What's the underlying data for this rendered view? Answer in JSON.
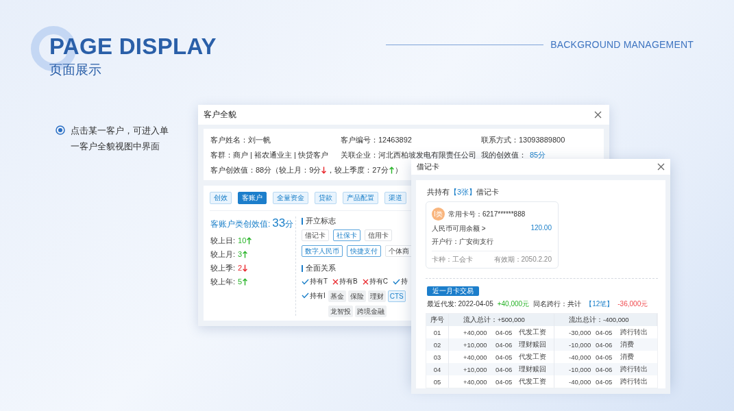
{
  "header": {
    "title": "PAGE DISPLAY",
    "subtitle": "页面展示",
    "section": "BACKGROUND MANAGEMENT"
  },
  "bullets": [
    {
      "text": "点击某一客户，可进入单一客户全貌视图中界面",
      "selected": true
    }
  ],
  "customer_window": {
    "title": "客户全貌",
    "fields": [
      {
        "label": "客户姓名：",
        "value": "刘一帆",
        "accent": false
      },
      {
        "label": "客户编号：",
        "value": "12463892",
        "accent": false
      },
      {
        "label": "联系方式：",
        "value": "13093889800",
        "accent": false
      },
      {
        "label": "客群：",
        "value": "商户 | 裕农通业主 | 快贷客户",
        "accent": false
      },
      {
        "label": "关联企业：",
        "value": "河北西柏坡发电有限责任公司",
        "accent": false
      },
      {
        "label": "我的创效值：",
        "value": "85分",
        "accent": true
      }
    ],
    "score_line": [
      {
        "text": "客户创效值：88分（较上月：9分",
        "rising": false
      },
      {
        "text": "，较上季度：27分",
        "rising": true
      },
      {
        "text": "）"
      }
    ],
    "tabs": [
      {
        "label": "创效",
        "selected": false
      },
      {
        "label": "客账户",
        "selected": true
      },
      {
        "label": "全量资金",
        "selected": false
      },
      {
        "label": "贷款",
        "selected": false
      },
      {
        "label": "产品配置",
        "selected": false
      },
      {
        "label": "渠道",
        "selected": false
      }
    ],
    "account_score": {
      "label": "客账户类创效值:",
      "value": "33",
      "unit": "分"
    },
    "comparisons": [
      {
        "label": "较上日:",
        "value": "10",
        "rising": true
      },
      {
        "label": "较上月:",
        "value": "3",
        "rising": true
      },
      {
        "label": "较上季:",
        "value": "2",
        "rising": false
      },
      {
        "label": "较上年:",
        "value": "5",
        "rising": true
      }
    ],
    "flags_title": "开立标志",
    "flags": [
      {
        "label": "借记卡",
        "highlighted": false
      },
      {
        "label": "社保卡",
        "highlighted": true
      },
      {
        "label": "信用卡",
        "highlighted": false
      },
      {
        "label": "数字人民币",
        "highlighted": true
      },
      {
        "label": "快捷支付",
        "highlighted": true
      },
      {
        "label": "个体商",
        "highlighted": false
      }
    ],
    "relations_title": "全面关系",
    "relations": [
      {
        "label": "持有T",
        "held": true
      },
      {
        "label": "持有B",
        "held": false
      },
      {
        "label": "持有C",
        "held": false
      },
      {
        "label": "持",
        "held": true
      },
      {
        "label": "持有I",
        "held": true
      }
    ],
    "products": [
      {
        "label": "基金",
        "highlighted": false
      },
      {
        "label": "保险",
        "highlighted": false
      },
      {
        "label": "理财",
        "highlighted": false
      },
      {
        "label": "CTS",
        "highlighted": true
      },
      {
        "label": "龙智投",
        "highlighted": false
      },
      {
        "label": "跨境金融",
        "highlighted": false
      }
    ]
  },
  "card_window": {
    "title": "借记卡",
    "summary": {
      "prefix": "共持有",
      "count": "【3张】",
      "suffix": "借记卡"
    },
    "card": {
      "badge": "I类",
      "number": "常用卡号：6217******888",
      "balance_label": "人民币可用余额 >",
      "balance": "120.00",
      "bank": "开户行：广安街支行",
      "type": "卡种：工会卡",
      "expiry": "有效期：2050.2.20"
    },
    "button": "近一月卡交易",
    "recent": [
      {
        "text": "最近代发: 2022-04-05",
        "kind": "label"
      },
      {
        "text": "+40,000元",
        "kind": "income"
      },
      {
        "text": "同名跨行：共计",
        "kind": "label"
      },
      {
        "text": "【12笔】",
        "kind": "count"
      },
      {
        "text": "-36,000元",
        "kind": "expense"
      }
    ],
    "table": {
      "columns": [
        "序号",
        "流入总计：+500,000",
        "",
        "",
        "流出总计：-400,000",
        "",
        ""
      ],
      "rows": [
        [
          "01",
          "+40,000",
          "04-05",
          "代发工资",
          "-30,000",
          "04-05",
          "跨行转出"
        ],
        [
          "02",
          "+10,000",
          "04-06",
          "理财赎回",
          "-10,000",
          "04-06",
          "消费"
        ],
        [
          "03",
          "+40,000",
          "04-05",
          "代发工资",
          "-40,000",
          "04-05",
          "消费"
        ],
        [
          "04",
          "+10,000",
          "04-06",
          "理财赎回",
          "-10,000",
          "04-06",
          "跨行转出"
        ],
        [
          "05",
          "+40,000",
          "04-05",
          "代发工资",
          "-40,000",
          "04-05",
          "跨行转出"
        ]
      ]
    }
  }
}
